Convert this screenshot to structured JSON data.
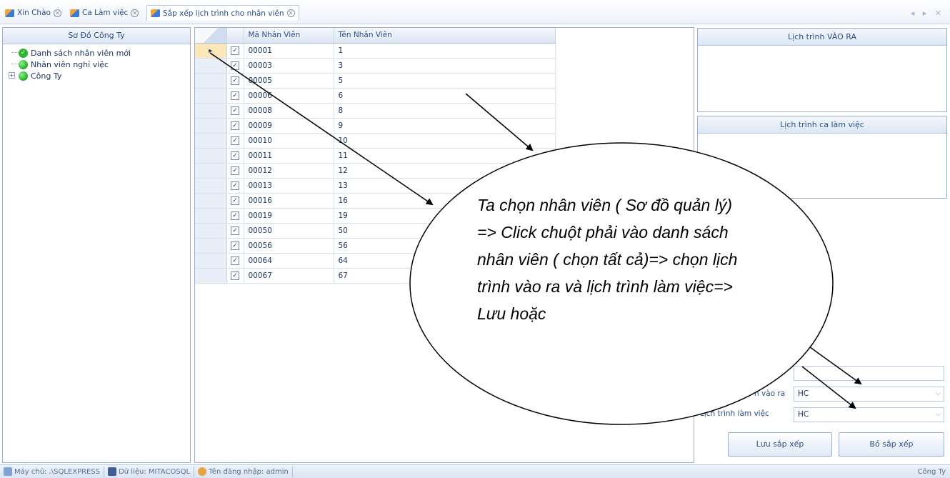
{
  "tabs": [
    {
      "label": "Xin Chào",
      "active": false
    },
    {
      "label": "Ca Làm việc",
      "active": false
    },
    {
      "label": "Sắp xếp lịch trình cho nhân viên",
      "active": true
    }
  ],
  "tab_nav": "◂ ▸ ✕",
  "left_panel": {
    "title": "Sơ Đồ Công Ty",
    "tree": [
      {
        "label": "Danh sách nhân viên mới",
        "icon": "check-circle-icon"
      },
      {
        "label": "Nhân viên nghỉ việc",
        "icon": "green-dot-icon"
      },
      {
        "label": "Công Ty",
        "icon": "green-dot-icon",
        "expander": "+"
      }
    ]
  },
  "grid": {
    "columns": [
      "Mã Nhân Viên",
      "Tên Nhân Viên"
    ],
    "rows": [
      {
        "id": "00001",
        "name": "1"
      },
      {
        "id": "00003",
        "name": "3"
      },
      {
        "id": "00005",
        "name": "5"
      },
      {
        "id": "00006",
        "name": "6"
      },
      {
        "id": "00008",
        "name": "8"
      },
      {
        "id": "00009",
        "name": "9"
      },
      {
        "id": "00010",
        "name": "10"
      },
      {
        "id": "00011",
        "name": "11"
      },
      {
        "id": "00012",
        "name": "12"
      },
      {
        "id": "00013",
        "name": "13"
      },
      {
        "id": "00016",
        "name": "16"
      },
      {
        "id": "00019",
        "name": "19"
      },
      {
        "id": "00050",
        "name": "50"
      },
      {
        "id": "00056",
        "name": "56"
      },
      {
        "id": "00064",
        "name": "64"
      },
      {
        "id": "00067",
        "name": "67"
      }
    ],
    "current_row_marker": "▸",
    "check_mark": "✓"
  },
  "right_panel": {
    "in_out_title": "Lịch trình VÀO RA",
    "shift_title": "Lịch trình ca làm việc",
    "in_out_label": "Lịch trình vào ra",
    "in_out_label_visible": "n vào ra",
    "in_out_value": "HC",
    "work_label": "Lịch trình làm việc",
    "work_value": "HC",
    "save_button": "Lưu sắp xếp",
    "unsave_button": "Bỏ sắp xếp"
  },
  "statusbar": {
    "server": "Máy chủ: .\\SQLEXPRESS",
    "database": "Dữ liệu: MITACOSQL",
    "user": "Tên đăng nhập: admin",
    "company": "Công Ty"
  },
  "annotation": {
    "text": "Ta chọn nhân viên ( Sơ đồ quản lý) => Click chuột phải vào danh sách nhân viên ( chọn tất cả)=> chọn lịch trình vào ra và lịch trình làm việc=> Lưu hoặc"
  },
  "colors": {
    "accent": "#2b4f88",
    "border": "#9aaed0",
    "current_row": "#fbe7b8"
  }
}
